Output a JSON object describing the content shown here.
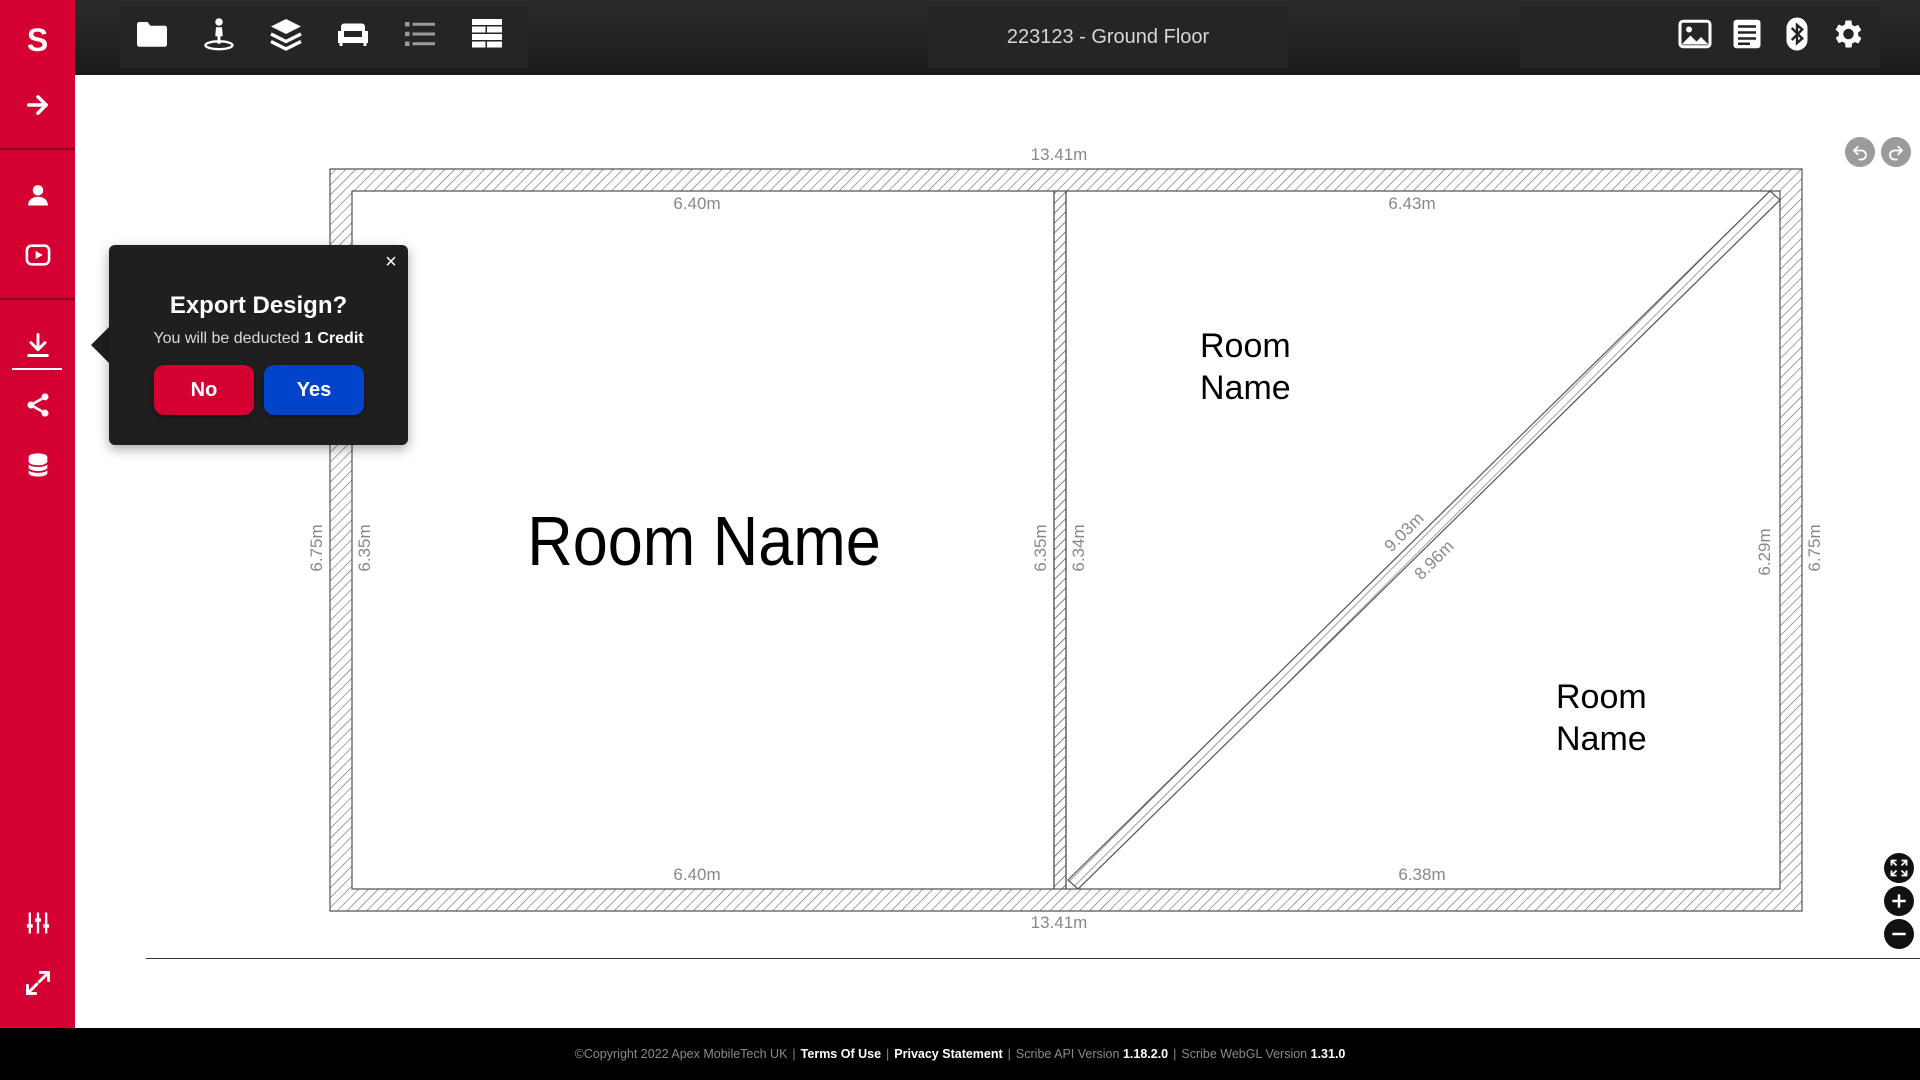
{
  "sidebar": {
    "logo": "S",
    "items": [
      "arrow-right-icon",
      "user-icon",
      "play-video-icon",
      "download-icon",
      "share-icon",
      "database-icon",
      "sliders-icon",
      "expand-icon"
    ]
  },
  "toolbar": {
    "left_icons": [
      "folder-icon",
      "person-pin-icon",
      "layers-icon",
      "sofa-icon",
      "list-icon",
      "wall-icon"
    ],
    "right_icons": [
      "image-icon",
      "notes-icon",
      "bluetooth-icon",
      "gear-icon"
    ],
    "title": "223123 - Ground Floor"
  },
  "plan": {
    "measurements": {
      "outer_top": "13.41m",
      "outer_bottom": "13.41m",
      "left_room_top": "6.40m",
      "left_room_bottom": "6.40m",
      "right_room_top": "6.43m",
      "right_room_bottom": "6.38m",
      "outer_left": "6.75m",
      "left_room_left": "6.35m",
      "left_room_right": "6.35m",
      "right_room_left": "6.34m",
      "right_room_right": "6.29m",
      "outer_right": "6.75m",
      "diagonal_a": "9.03m",
      "diagonal_b": "8.96m"
    },
    "rooms": {
      "main": "Room Name",
      "upper_line1": "Room",
      "upper_line2": "Name",
      "lower_line1": "Room",
      "lower_line2": "Name"
    }
  },
  "popup": {
    "title": "Export Design?",
    "message_prefix": "You will be deducted",
    "message_bold": "1 Credit",
    "no_label": "No",
    "yes_label": "Yes",
    "close_label": "×"
  },
  "footer": {
    "copyright": "©Copyright 2022 Apex MobileTech UK",
    "terms": "Terms Of Use",
    "privacy": "Privacy Statement",
    "api_label": "Scribe API Version",
    "api_version": "1.18.2.0",
    "webgl_label": "Scribe WebGL Version",
    "webgl_version": "1.31.0"
  },
  "colors": {
    "brand_red": "#d30031",
    "yes_blue": "#0044cc",
    "topbar": "#1f1f1f"
  }
}
